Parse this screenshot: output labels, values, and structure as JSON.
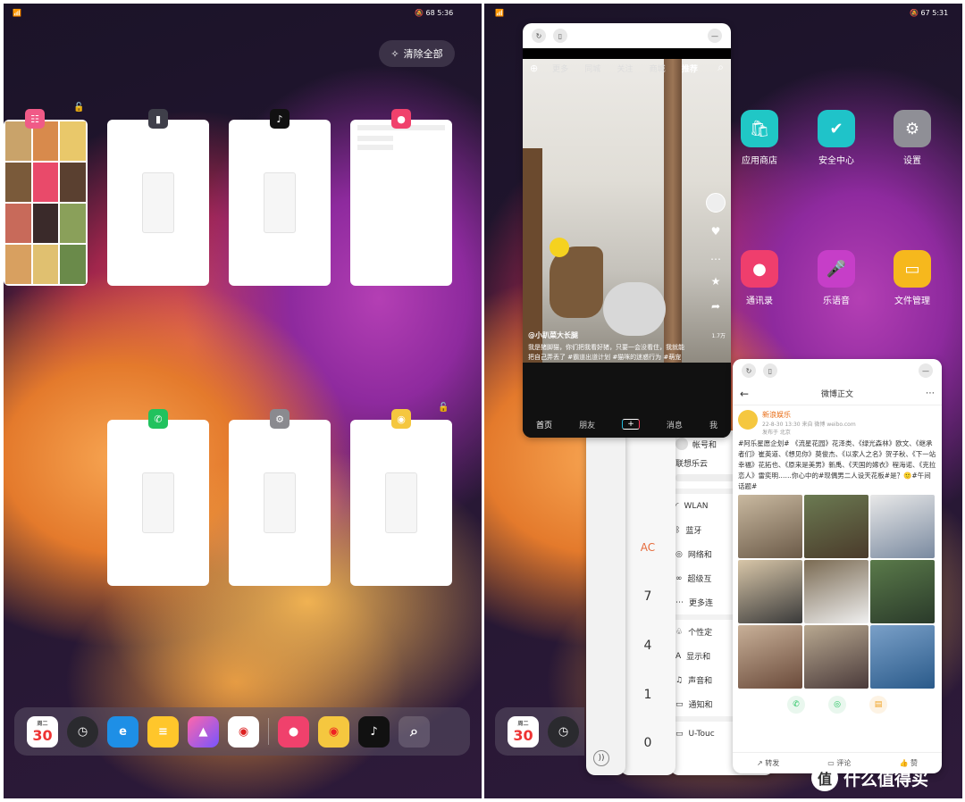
{
  "left": {
    "status_time": "5:36",
    "battery": "68",
    "clear_all_label": "清除全部",
    "cards": [
      {
        "app": "app-shop",
        "badge_color": "#f05a87"
      },
      {
        "app": "phone",
        "badge_color": "#3f3f4a"
      },
      {
        "app": "tiktok",
        "badge_color": "#111111"
      },
      {
        "app": "contacts",
        "badge_color": "#f0416c"
      },
      {
        "app": "wechat",
        "badge_color": "#21c25e"
      },
      {
        "app": "settings",
        "badge_color": "#8a8a8f"
      },
      {
        "app": "weibo",
        "badge_color": "#f5c73f"
      }
    ],
    "dock": {
      "calendar_weekday": "周二",
      "calendar_day": "30"
    }
  },
  "right": {
    "status_time": "5:31",
    "battery": "67",
    "home_apps": [
      {
        "label": "应用商店",
        "icon": "store-icon",
        "color": "#20c7c6"
      },
      {
        "label": "安全中心",
        "icon": "shield-icon",
        "color": "#1fc3c9"
      },
      {
        "label": "设置",
        "icon": "gear-icon",
        "color": "#8f8f96"
      },
      {
        "label": "通讯录",
        "icon": "contacts-icon",
        "color": "#ef3e6d"
      },
      {
        "label": "乐语音",
        "icon": "mic-icon",
        "color": "#c63ec8"
      },
      {
        "label": "文件管理",
        "icon": "folder-icon",
        "color": "#f6b81d"
      }
    ],
    "douyin": {
      "tabs": [
        "更多",
        "同城",
        "关注",
        "商城",
        "推荐"
      ],
      "author": "@小趴菜大长腿",
      "caption": "我是猪脚猫，你们把我看好猪，只要一会没看住，我就能把自己弄丢了 #霸道出道计划 #猫咪的迷惑行为 #萌宠",
      "likes": "1.7万",
      "nav": [
        "首页",
        "朋友",
        "+",
        "消息",
        "我"
      ]
    },
    "settings_window": {
      "account": "联想乐云",
      "account_hint": "帐号和",
      "items": [
        "WLAN",
        "蓝牙",
        "网络和",
        "超级互",
        "更多连",
        "个性定",
        "显示和",
        "声音和",
        "通知和",
        "U-Touc"
      ]
    },
    "calculator": {
      "keys": [
        "AC",
        "7",
        "4",
        "1",
        "0"
      ]
    },
    "weibo": {
      "title": "微博正文",
      "user": "新浪娱乐",
      "meta": "22-8-30 13:30  来自 微博 weibo.com",
      "location": "发布于 北京",
      "text": "#阿乐星愿企划# 《流星花园》花泽类、《绿光森林》欧文、《继承者们》崔英道、《想见你》莫俊杰、《以家人之名》贺子秋、《下一站幸福》花拓也、《原来是美男》新禹、《天国的嫁衣》程海诺、《克拉恋人》雷奕明……你心中的#现偶男二人设天花板#是？🙂#午间话题#",
      "actions": [
        "转发",
        "评论",
        "赞"
      ]
    },
    "dock": {
      "calendar_weekday": "周二",
      "calendar_day": "30"
    }
  },
  "watermark": "什么值得买"
}
